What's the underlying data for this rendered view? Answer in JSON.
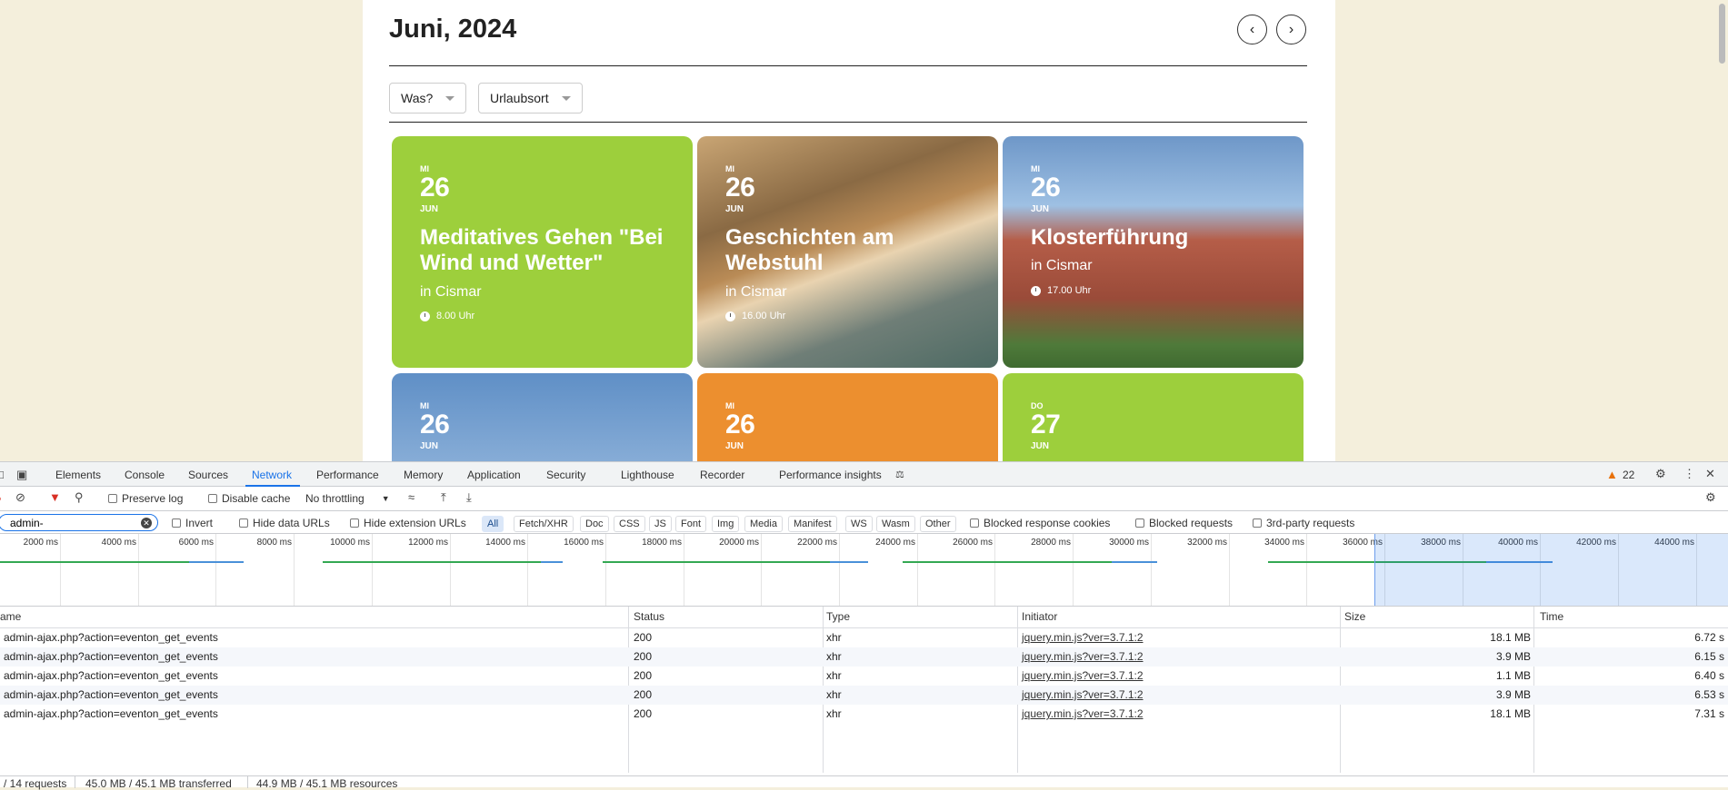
{
  "site": {
    "month_title": "Juni, 2024",
    "filters": {
      "what": "Was?",
      "place": "Urlaubsort"
    },
    "cards": [
      {
        "weekday": "MI",
        "day": "26",
        "month": "JUN",
        "title": "Meditatives Gehen \"Bei Wind und Wetter\"",
        "location": "in Cismar",
        "time": "8.00 Uhr",
        "bg": "green"
      },
      {
        "weekday": "MI",
        "day": "26",
        "month": "JUN",
        "title": "Geschichten am Webstuhl",
        "location": "in Cismar",
        "time": "16.00 Uhr",
        "bg": "weaving-photo"
      },
      {
        "weekday": "MI",
        "day": "26",
        "month": "JUN",
        "title": "Klosterführung",
        "location": "in Cismar",
        "time": "17.00 Uhr",
        "bg": "brick-church-photo"
      },
      {
        "weekday": "MI",
        "day": "26",
        "month": "JUN",
        "bg": "sky-photo"
      },
      {
        "weekday": "MI",
        "day": "26",
        "month": "JUN",
        "bg": "orange"
      },
      {
        "weekday": "DO",
        "day": "27",
        "month": "JUN",
        "bg": "green"
      }
    ],
    "colors": {
      "green": "#9dcf3c",
      "orange": "#ec8f2f",
      "background": "#f4efdc"
    }
  },
  "devtools": {
    "tabs": [
      "Elements",
      "Console",
      "Sources",
      "Network",
      "Performance",
      "Memory",
      "Application",
      "Security",
      "Lighthouse",
      "Recorder",
      "Performance insights"
    ],
    "active_tab": "Network",
    "warning_count": "22",
    "toolbar": {
      "preserve_log": "Preserve log",
      "disable_cache": "Disable cache",
      "throttling": "No throttling"
    },
    "filter": {
      "value": "admin-",
      "invert": "Invert",
      "hide_data_urls": "Hide data URLs",
      "hide_extension_urls": "Hide extension URLs",
      "types": [
        "All",
        "Fetch/XHR",
        "Doc",
        "CSS",
        "JS",
        "Font",
        "Img",
        "Media",
        "Manifest",
        "WS",
        "Wasm",
        "Other"
      ],
      "active_type": "All",
      "blocked_response_cookies": "Blocked response cookies",
      "blocked_requests": "Blocked requests",
      "third_party_requests": "3rd-party requests"
    },
    "timeline_ticks": [
      "2000 ms",
      "4000 ms",
      "6000 ms",
      "8000 ms",
      "10000 ms",
      "12000 ms",
      "14000 ms",
      "16000 ms",
      "18000 ms",
      "20000 ms",
      "22000 ms",
      "24000 ms",
      "26000 ms",
      "28000 ms",
      "30000 ms",
      "32000 ms",
      "34000 ms",
      "36000 ms",
      "38000 ms",
      "40000 ms",
      "42000 ms",
      "44000 ms"
    ],
    "columns": {
      "name": "ame",
      "status": "Status",
      "type": "Type",
      "initiator": "Initiator",
      "size": "Size",
      "time": "Time"
    },
    "rows": [
      {
        "name": "admin-ajax.php?action=eventon_get_events",
        "status": "200",
        "type": "xhr",
        "initiator": "jquery.min.js?ver=3.7.1:2",
        "size": "18.1 MB",
        "time": "6.72 s"
      },
      {
        "name": "admin-ajax.php?action=eventon_get_events",
        "status": "200",
        "type": "xhr",
        "initiator": "jquery.min.js?ver=3.7.1:2",
        "size": "3.9 MB",
        "time": "6.15 s"
      },
      {
        "name": "admin-ajax.php?action=eventon_get_events",
        "status": "200",
        "type": "xhr",
        "initiator": "jquery.min.js?ver=3.7.1:2",
        "size": "1.1 MB",
        "time": "6.40 s"
      },
      {
        "name": "admin-ajax.php?action=eventon_get_events",
        "status": "200",
        "type": "xhr",
        "initiator": "jquery.min.js?ver=3.7.1:2",
        "size": "3.9 MB",
        "time": "6.53 s"
      },
      {
        "name": "admin-ajax.php?action=eventon_get_events",
        "status": "200",
        "type": "xhr",
        "initiator": "jquery.min.js?ver=3.7.1:2",
        "size": "18.1 MB",
        "time": "7.31 s"
      }
    ],
    "status_bar": {
      "requests": "/ 14 requests",
      "transferred": "45.0 MB / 45.1 MB transferred",
      "resources": "44.9 MB / 45.1 MB resources"
    }
  }
}
